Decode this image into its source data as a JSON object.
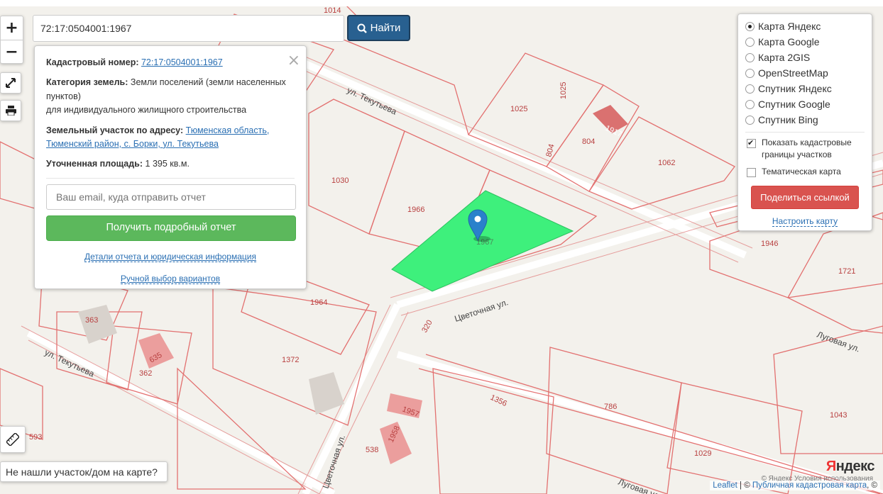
{
  "search": {
    "value": "72:17:0504001:1967",
    "button_label": "Найти"
  },
  "zoom": {
    "in": "+",
    "out": "−"
  },
  "info_card": {
    "cadastral_label": "Кадастровый номер:",
    "cadastral_value": "72:17:0504001:1967",
    "category_label": "Категория земель:",
    "category_value": "Земли поселений (земли населенных пунктов)",
    "category_value_2": "для индивидуального жилищного строительства",
    "address_label": "Земельный участок по адресу:",
    "address_value": "Тюменская область, Тюменский район, с. Борки, ул. Текутьева",
    "area_label": "Уточненная площадь:",
    "area_value": "1 395 кв.м.",
    "email_placeholder": "Ваш email, куда отправить отчет",
    "report_button": "Получить подробный отчет",
    "details_link": "Детали отчета и юридическая информация",
    "manual_link": "Ручной выбор вариантов",
    "close": "×"
  },
  "layers": {
    "options": [
      {
        "label": "Карта Яндекс",
        "selected": true
      },
      {
        "label": "Карта Google",
        "selected": false
      },
      {
        "label": "Карта 2GIS",
        "selected": false
      },
      {
        "label": "OpenStreetMap",
        "selected": false
      },
      {
        "label": "Спутник Яндекс",
        "selected": false
      },
      {
        "label": "Спутник Google",
        "selected": false
      },
      {
        "label": "Спутник Bing",
        "selected": false
      }
    ],
    "show_cadastral": "Показать кадастровые границы участков",
    "thematic": "Тематическая карта",
    "share_button": "Поделиться ссылкой",
    "configure_link": "Настроить карту"
  },
  "not_found": "Не нашли участок/дом на карте?",
  "attribution": {
    "leaflet": "Leaflet",
    "sep": " | © ",
    "pkk": "Публичная кадастровая карта",
    "end": ", ©"
  },
  "yandex": {
    "logo_red": "Я",
    "logo_rest": "ндекс",
    "terms": "© Яндекс  Условия использования"
  },
  "map_labels": {
    "parcels": [
      "1014",
      "1025",
      "1025",
      "804",
      "804",
      "1062",
      "1030",
      "1966",
      "1967",
      "1946",
      "1721",
      "1964",
      "363",
      "635",
      "362",
      "1372",
      "320",
      "1356",
      "786",
      "1043",
      "1957",
      "1958",
      "538",
      "593",
      "1029",
      "1917"
    ],
    "streets": [
      "ул. Текутьева",
      "ул. Текутьева",
      "Цветочная ул.",
      "Луговая ул.",
      "Цветочная ул.",
      "Луговая ул."
    ]
  },
  "colors": {
    "parcel_line": "#e05a5a",
    "selected_parcel": "#3ef07c",
    "marker": "#2a81cb",
    "map_bg": "#f3f1ec"
  }
}
